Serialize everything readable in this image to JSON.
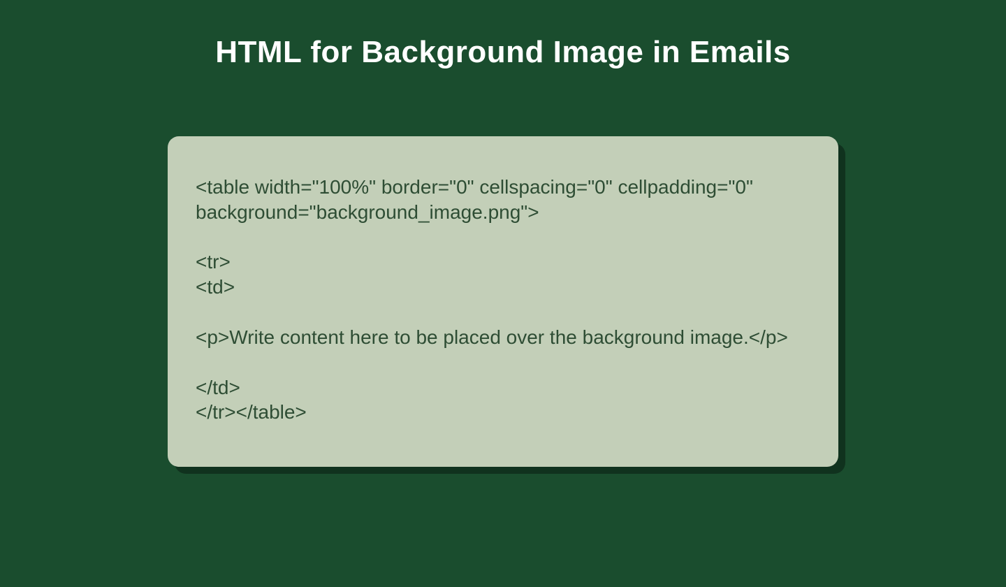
{
  "title": "HTML for Background Image in Emails",
  "code": {
    "line1": "<table width=\"100%\" border=\"0\" cellspacing=\"0\" cellpadding=\"0\" background=\"background_image.png\">",
    "line2": "",
    "line3": "<tr>",
    "line4": "<td>",
    "line5": "",
    "line6": "<p>Write content here to be placed over the background image.</p>",
    "line7": "",
    "line8": "</td>",
    "line9": "</tr></table>"
  }
}
